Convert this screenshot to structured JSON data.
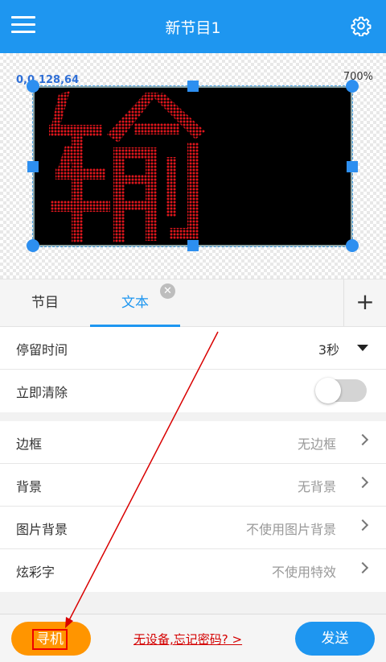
{
  "header": {
    "title": "新节目1",
    "menu_icon": "hamburger-menu-icon",
    "settings_icon": "gear-icon"
  },
  "canvas": {
    "coordinates": "0,0,128,64",
    "zoom": "700%",
    "display_character": "输",
    "led_color": "#e0161c"
  },
  "tabs": [
    {
      "label": "节目"
    },
    {
      "label": "文本"
    }
  ],
  "settings": {
    "dwell_time": {
      "label": "停留时间",
      "value": "3秒"
    },
    "clear_immediately": {
      "label": "立即清除",
      "enabled": false
    },
    "border": {
      "label": "边框",
      "value": "无边框"
    },
    "background": {
      "label": "背景",
      "value": "无背景"
    },
    "image_background": {
      "label": "图片背景",
      "value": "不使用图片背景"
    },
    "colorful_text": {
      "label": "炫彩字",
      "value": "不使用特效"
    }
  },
  "bottom": {
    "find_button": "寻机",
    "help_link": "无设备,忘记密码? >",
    "send_button": "发送"
  },
  "colors": {
    "primary": "#1e96f0",
    "find_button": "#ff9500",
    "link": "#d40000"
  }
}
